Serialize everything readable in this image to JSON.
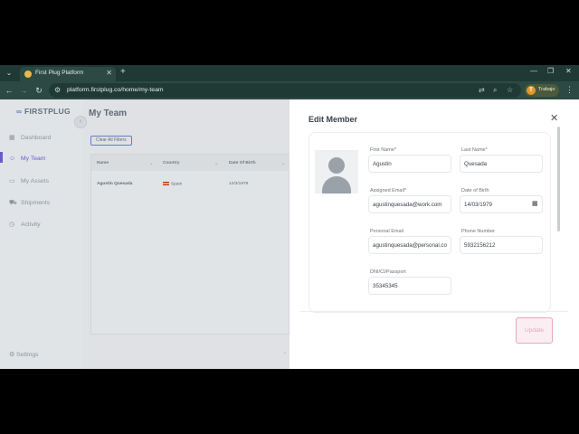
{
  "browser": {
    "tab_title": "First Plug Platform",
    "url": "platform.firstplug.co/home/my-team",
    "profile_label": "Trabajo",
    "profile_initial": "T"
  },
  "sidebar": {
    "logo_text": "FIRSTPLUG",
    "items": [
      {
        "label": "Dashboard",
        "icon": "dashboard-icon",
        "active": false
      },
      {
        "label": "My Team",
        "icon": "team-icon",
        "active": true
      },
      {
        "label": "My Assets",
        "icon": "assets-icon",
        "active": false
      },
      {
        "label": "Shipments",
        "icon": "shipments-icon",
        "active": false
      },
      {
        "label": "Activity",
        "icon": "activity-icon",
        "active": false
      }
    ],
    "settings_label": "Settings"
  },
  "main": {
    "title": "My Team",
    "clear_filters_label": "Clear All Filters",
    "table": {
      "columns": [
        "Name",
        "Country",
        "Date Of Birth"
      ],
      "rows": [
        {
          "name": "Agustin Quesada",
          "country": "Spain",
          "dob": "14/3/1979"
        }
      ]
    }
  },
  "panel": {
    "title": "Edit Member",
    "fields": {
      "first_name": {
        "label": "First Name*",
        "value": "Agustin"
      },
      "last_name": {
        "label": "Last Name*",
        "value": "Quesada"
      },
      "assigned_email": {
        "label": "Assigned Email*",
        "value": "agustinquesada@work.com"
      },
      "date_of_birth": {
        "label": "Date of Birth",
        "value": "14/03/1979"
      },
      "personal_email": {
        "label": "Personal Email",
        "value": "agustinquesada@personal.com"
      },
      "phone": {
        "label": "Phone Number",
        "value": "5932156212"
      },
      "dni": {
        "label": "DNI/CI/Passport",
        "value": "35345345"
      }
    },
    "update_label": "Update"
  },
  "colors": {
    "accent": "#6b4fd6",
    "update_button_border": "#e7a8b8",
    "browser_chrome": "#2c4a43"
  }
}
